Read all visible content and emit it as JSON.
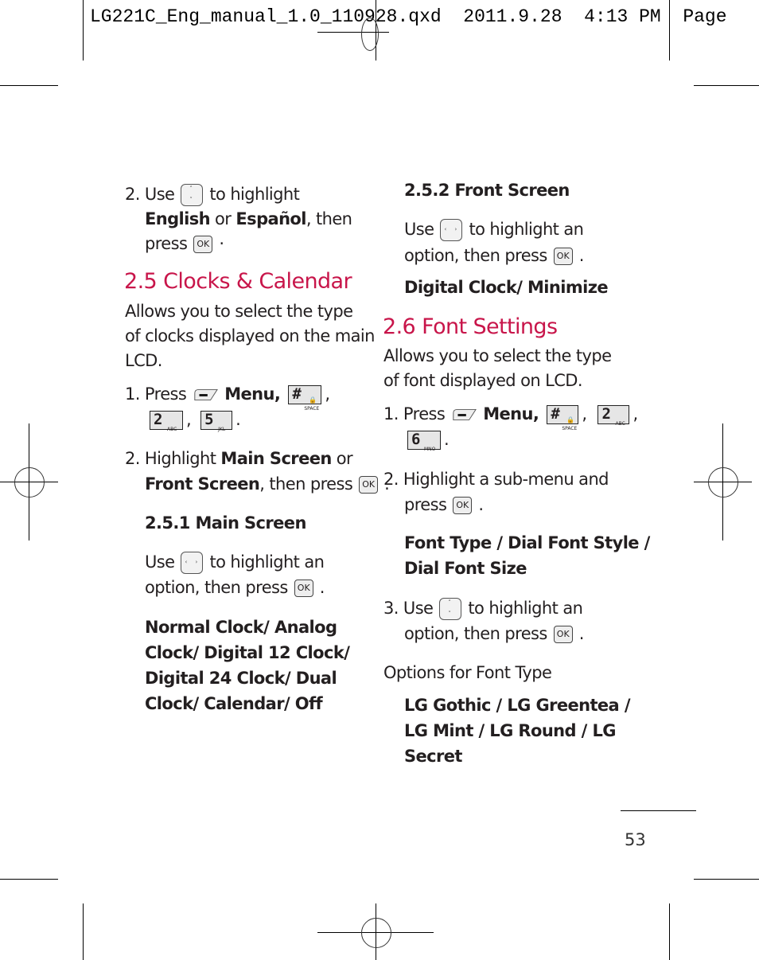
{
  "slug": {
    "text": "LG221C_Eng_manual_1.0_110928.qxd  2011.9.28  4:13 PM  Page"
  },
  "icons": {
    "updown_nav": "up-down-navigation-key-icon",
    "leftright_nav": "left-right-navigation-key-icon",
    "ok": "ok-key-icon",
    "ok_label": "OK",
    "left_softkey": "left-soft-key-icon",
    "key_hash": {
      "main": "#",
      "sub": "SPACE"
    },
    "key_2": {
      "main": "2",
      "sub": "ABC"
    },
    "key_5": {
      "main": "5",
      "sub": "JKL"
    },
    "key_6": {
      "main": "6",
      "sub": "MNO"
    }
  },
  "colors": {
    "heading": "#c8154a",
    "text": "#231f20"
  },
  "left_column": {
    "step2_prev": {
      "num": "2.",
      "use": "Use",
      "to_highlight": "to highlight",
      "english": "English",
      "or": " or ",
      "espanol": "Español",
      "then": ", then",
      "press": "press",
      "dot": "·"
    },
    "section_25": {
      "title": "2.5 Clocks & Calendar",
      "desc_lines": [
        "Allows you to select the type",
        "of clocks displayed on the main",
        "LCD."
      ],
      "step1": {
        "num": "1.",
        "press": "Press",
        "menu": "Menu,",
        "comma": ",",
        "period": "."
      },
      "step2": {
        "num": "2.",
        "highlight": "Highlight ",
        "main_screen": "Main Screen",
        "or": " or",
        "front_screen": "Front Screen",
        "then_press": ", then press",
        "period": "."
      },
      "sub_251": {
        "title": "2.5.1 Main Screen",
        "use": "Use",
        "to_highlight_an": "to highlight an",
        "option_then_press": "option, then press",
        "period": ".",
        "options_lines": [
          "Normal Clock/ Analog",
          "Clock/ Digital 12 Clock/",
          "Digital 24 Clock/ Dual",
          "Clock/ Calendar/ Off"
        ]
      }
    }
  },
  "right_column": {
    "sub_252": {
      "title": "2.5.2 Front Screen",
      "use": "Use",
      "to_highlight_an": "to highlight an",
      "option_then_press": "option, then press",
      "period": ".",
      "options": "Digital Clock/ Minimize"
    },
    "section_26": {
      "title": "2.6 Font Settings",
      "desc_lines": [
        "Allows you to select the type",
        "of font displayed on LCD."
      ],
      "step1": {
        "num": "1.",
        "press": "Press",
        "menu": "Menu,",
        "comma": ",",
        "period": "."
      },
      "step2": {
        "num": "2.",
        "line1": "Highlight a sub-menu and",
        "press": "press",
        "period": "."
      },
      "submenu_lines": [
        "Font Type / Dial Font Style /",
        "Dial Font Size"
      ],
      "step3": {
        "num": "3.",
        "use": "Use",
        "to_highlight_an": "to highlight an",
        "option_then_press": "option, then press",
        "period": "."
      },
      "options_label": "Options for Font Type",
      "font_type_lines": [
        "LG Gothic / LG Greentea /",
        "LG Mint / LG Round / LG",
        "Secret"
      ]
    }
  },
  "footer": {
    "page_number": "53"
  }
}
